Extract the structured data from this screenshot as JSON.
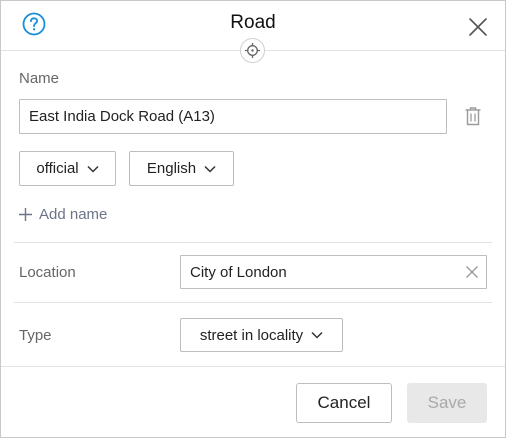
{
  "header": {
    "title": "Road",
    "help_icon": "question-circle-icon",
    "close_icon": "close-icon",
    "locate_icon": "crosshair-icon",
    "accent_color": "#1a8fd8"
  },
  "name_section": {
    "label": "Name",
    "name_value": "East India Dock Road (A13)",
    "delete_icon": "trash-icon",
    "type_select": "official",
    "language_select": "English",
    "add_name_label": "Add name"
  },
  "location_section": {
    "label": "Location",
    "value": "City of London",
    "clear_icon": "clear-icon"
  },
  "type_section": {
    "label": "Type",
    "value": "street in locality"
  },
  "footer": {
    "cancel_label": "Cancel",
    "save_label": "Save"
  }
}
